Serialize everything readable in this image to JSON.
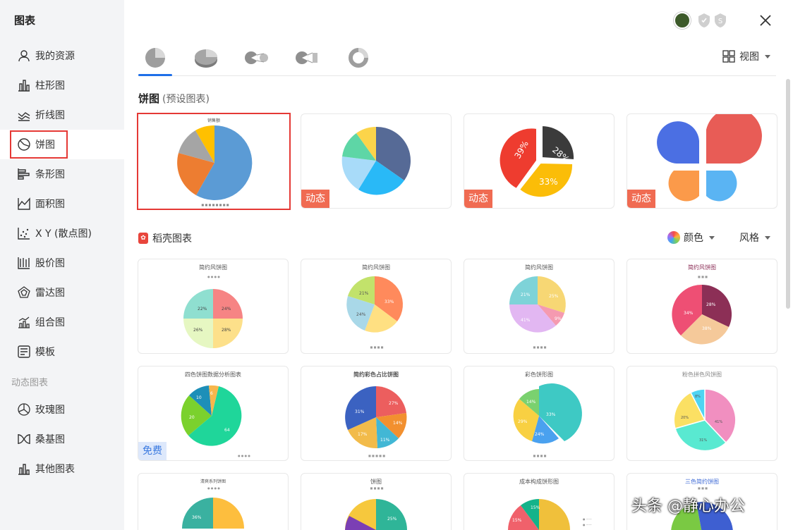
{
  "sidebar": {
    "title": "图表",
    "items": [
      {
        "label": "我的资源",
        "icon": "user-icon"
      },
      {
        "label": "柱形图",
        "icon": "bar-chart-icon"
      },
      {
        "label": "折线图",
        "icon": "line-chart-icon"
      },
      {
        "label": "饼图",
        "icon": "pie-chart-icon"
      },
      {
        "label": "条形图",
        "icon": "hbar-chart-icon"
      },
      {
        "label": "面积图",
        "icon": "area-chart-icon"
      },
      {
        "label": "X Y (散点图)",
        "icon": "scatter-chart-icon"
      },
      {
        "label": "股价图",
        "icon": "stock-chart-icon"
      },
      {
        "label": "雷达图",
        "icon": "radar-chart-icon"
      },
      {
        "label": "组合图",
        "icon": "combo-chart-icon"
      },
      {
        "label": "模板",
        "icon": "template-icon"
      }
    ],
    "section_label": "动态图表",
    "dynamic_items": [
      {
        "label": "玫瑰图",
        "icon": "rose-chart-icon"
      },
      {
        "label": "桑基图",
        "icon": "sankey-chart-icon"
      },
      {
        "label": "其他图表",
        "icon": "other-chart-icon"
      }
    ],
    "active": "饼图"
  },
  "toolbar": {
    "view_label": "视图"
  },
  "preset": {
    "title": "饼图",
    "subtitle": "(预设图表)"
  },
  "preset_cards": [
    {
      "tag": "",
      "title": "销售额"
    },
    {
      "tag": "动态"
    },
    {
      "tag": "动态",
      "labels": [
        "39%",
        "28%",
        "33%"
      ]
    },
    {
      "tag": "动态"
    }
  ],
  "daoke": {
    "title": "稻壳图表",
    "color_label": "颜色",
    "style_label": "风格"
  },
  "template_cards": [
    {
      "title": "简约风饼图",
      "labels": [
        "22%",
        "24%",
        "26%",
        "28%"
      ]
    },
    {
      "title": "简约风饼图",
      "labels": [
        "21%",
        "33%",
        "24%"
      ]
    },
    {
      "title": "简约风饼图",
      "labels": [
        "21%",
        "25%",
        "9%",
        "41%"
      ]
    },
    {
      "title": "简约风饼图",
      "labels": [
        "28%",
        "38%",
        "34%"
      ]
    },
    {
      "title": "四色饼图数据分析图表",
      "labels": [
        "64",
        "20",
        "10",
        "6"
      ],
      "tag": "免费"
    },
    {
      "title": "简约彩色占比饼图",
      "labels": [
        "27%",
        "14%",
        "11%",
        "17%",
        "31%"
      ]
    },
    {
      "title": "彩色饼形图",
      "labels": [
        "33%",
        "24%",
        "29%",
        "14%"
      ]
    },
    {
      "title": "粉色拼色风饼图",
      "labels": [
        "41%",
        "31%",
        "20%",
        "8%"
      ]
    },
    {
      "title": "清爽系列饼图",
      "labels": [
        "36%"
      ]
    },
    {
      "title": "饼图",
      "labels": [
        "25%"
      ]
    },
    {
      "title": "成本构成饼形图",
      "labels": [
        "15%",
        "15%"
      ]
    },
    {
      "title": "三色简约饼图",
      "labels": []
    }
  ],
  "watermark": "头条 @静心办公"
}
